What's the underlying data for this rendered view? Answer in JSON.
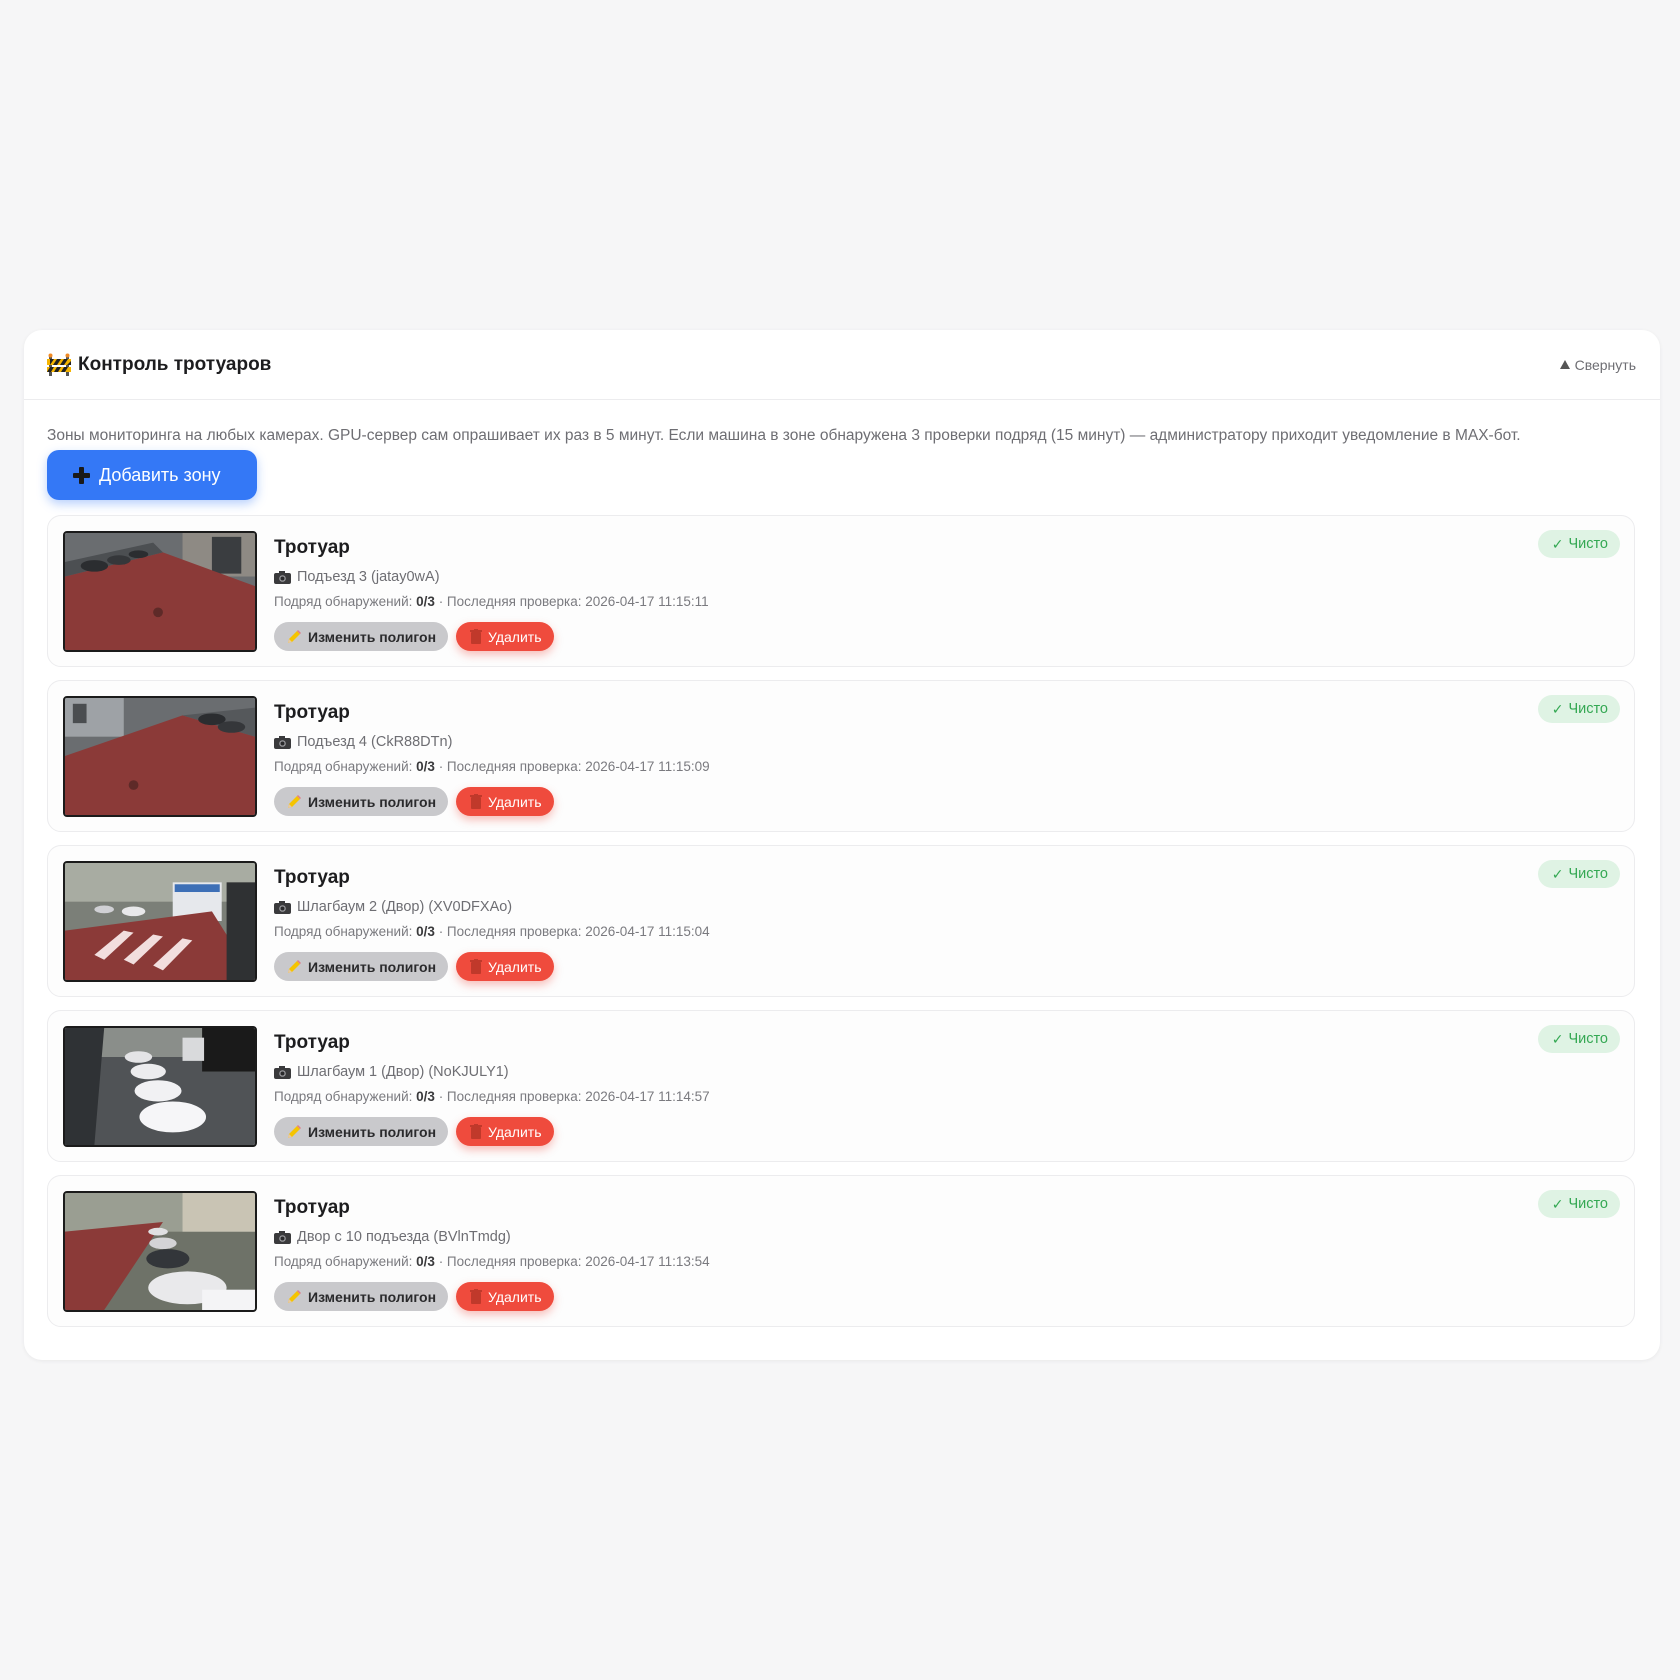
{
  "panel": {
    "title": "Контроль тротуаров",
    "icon": "barrier-icon",
    "collapse_label": "Свернуть",
    "description": "Зоны мониторинга на любых камерах. GPU-сервер сам опрашивает их раз в 5 минут. Если машина в зоне обнаружена 3 проверки подряд (15 минут) — администратору приходит уведомление в MAX-бот.",
    "add_button_label": "Добавить зону"
  },
  "labels": {
    "streak_prefix": "Подряд обнаружений:",
    "last_check_prefix": "· Последняя проверка:",
    "edit_button": "Изменить полигон",
    "delete_button": "Удалить",
    "status_clean": "Чисто",
    "status_check_glyph": "✓"
  },
  "colors": {
    "accent": "#3478f6",
    "danger": "#ef4b3d",
    "status_clean_bg": "#dff3e4",
    "status_clean_text": "#34a853"
  },
  "zones": [
    {
      "name": "Тротуар",
      "camera": "Подъезд 3 (jatay0wA)",
      "streak": "0/3",
      "last_check": "2026-04-17 11:15:11"
    },
    {
      "name": "Тротуар",
      "camera": "Подъезд 4 (CkR88DTn)",
      "streak": "0/3",
      "last_check": "2026-04-17 11:15:09"
    },
    {
      "name": "Тротуар",
      "camera": "Шлагбаум 2 (Двор) (XV0DFXAo)",
      "streak": "0/3",
      "last_check": "2026-04-17 11:15:04"
    },
    {
      "name": "Тротуар",
      "camera": "Шлагбаум 1 (Двор) (NoKJULY1)",
      "streak": "0/3",
      "last_check": "2026-04-17 11:14:57"
    },
    {
      "name": "Тротуар",
      "camera": "Двор с 10 подъезда (BVlnTmdg)",
      "streak": "0/3",
      "last_check": "2026-04-17 11:13:54"
    }
  ]
}
